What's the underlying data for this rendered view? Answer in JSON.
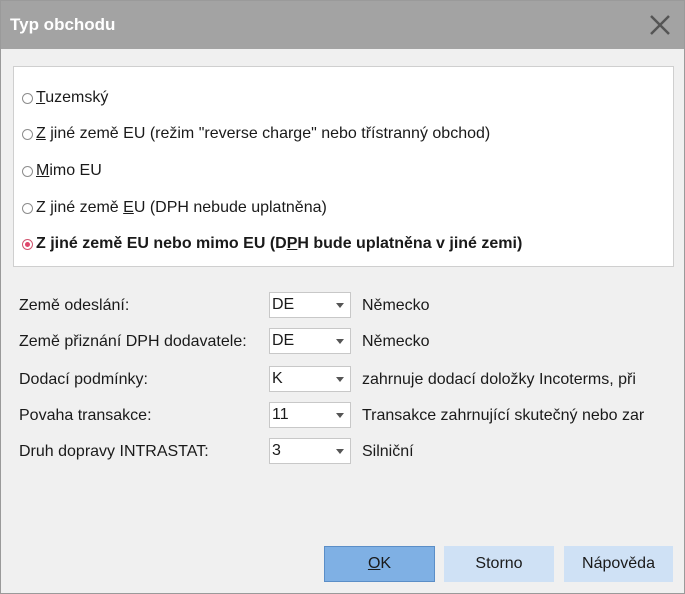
{
  "title": "Typ obchodu",
  "icons": {
    "close": "close-x-icon"
  },
  "colors": {
    "titlebar": "#a3a3a3",
    "primary_button": "#7fb0e4",
    "secondary_button": "#cfe1f5",
    "radio_selected": "#e0466b"
  },
  "radio_options": [
    {
      "pre": "",
      "mnemonic": "T",
      "post": "uzemský",
      "selected": false
    },
    {
      "pre": "",
      "mnemonic": "Z",
      "post": " jiné země EU (režim \"reverse charge\" nebo třístranný obchod)",
      "selected": false
    },
    {
      "pre": "",
      "mnemonic": "M",
      "post": "imo EU",
      "selected": false
    },
    {
      "pre": "Z jiné země ",
      "mnemonic": "E",
      "post": "U (DPH nebude uplatněna)",
      "selected": false
    },
    {
      "pre": "Z jiné země EU nebo mimo EU (D",
      "mnemonic": "P",
      "post": "H bude uplatněna v jiné zemi)",
      "selected": true
    }
  ],
  "fields": [
    {
      "label": "Země odeslání:",
      "value": "DE",
      "description": "Německo"
    },
    {
      "label": "Země přiznání DPH dodavatele:",
      "value": "DE",
      "description": "Německo"
    },
    {
      "label": "Dodací podmínky:",
      "value": "K",
      "description": "zahrnuje dodací doložky Incoterms, při"
    },
    {
      "label": "Povaha transakce:",
      "value": "11",
      "description": "Transakce zahrnující skutečný nebo zar"
    },
    {
      "label": "Druh dopravy INTRASTAT:",
      "value": "3",
      "description": "Silniční"
    }
  ],
  "buttons": {
    "ok": {
      "mnemonic": "O",
      "post": "K"
    },
    "cancel": "Storno",
    "help": "Nápověda"
  }
}
